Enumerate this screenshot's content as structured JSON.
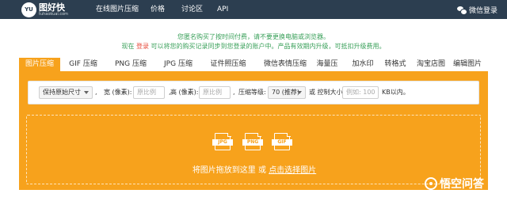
{
  "colors": {
    "nav_bg": "#2c3e50",
    "accent": "#f7a21c",
    "notice_green": "#3aa05a",
    "notice_red": "#e74c3c"
  },
  "nav": {
    "logo_badge": "YU",
    "logo_name": "图好快",
    "logo_domain": "tuhaokuai.com",
    "links": [
      "在线图片压缩",
      "价格",
      "讨论区",
      "API"
    ],
    "login": "微信登录",
    "login_icon": "wechat-icon"
  },
  "notice": {
    "line1": "您匿名购买了按时间付费，请不要更换电脑或浏览器。",
    "line2_prefix": "现在",
    "line2_link": "登录",
    "line2_suffix": "可以将您的购买记录同步到您登录的账户中。产品有效期内升级，可抵扣升级费用。"
  },
  "tabs": [
    "图片压缩",
    "GIF 压缩",
    "PNG 压缩",
    "JPG 压缩",
    "证件照压缩",
    "微信表情压缩",
    "海量压缩",
    "加水印",
    "转格式",
    "淘宝店图",
    "编辑图片"
  ],
  "options": {
    "size_select": "保持原始尺寸",
    "width_label": "宽 (像素):",
    "width_placeholder": "原比例",
    "height_label": "高 (像素):",
    "height_placeholder": "原比例",
    "level_label": "压缩等级:",
    "level_select": "70 (推荐)",
    "or_size_label": "或 控制大小",
    "size_placeholder": "例如: 100",
    "size_unit": "KB以内。"
  },
  "dropzone": {
    "icons": [
      "JPG",
      "PNG",
      "GIF"
    ],
    "text_prefix": "将图片拖放到这里 或",
    "text_link": "点击选择图片"
  },
  "watermark": {
    "text": "悟空问答",
    "icon": "wukong-icon"
  }
}
